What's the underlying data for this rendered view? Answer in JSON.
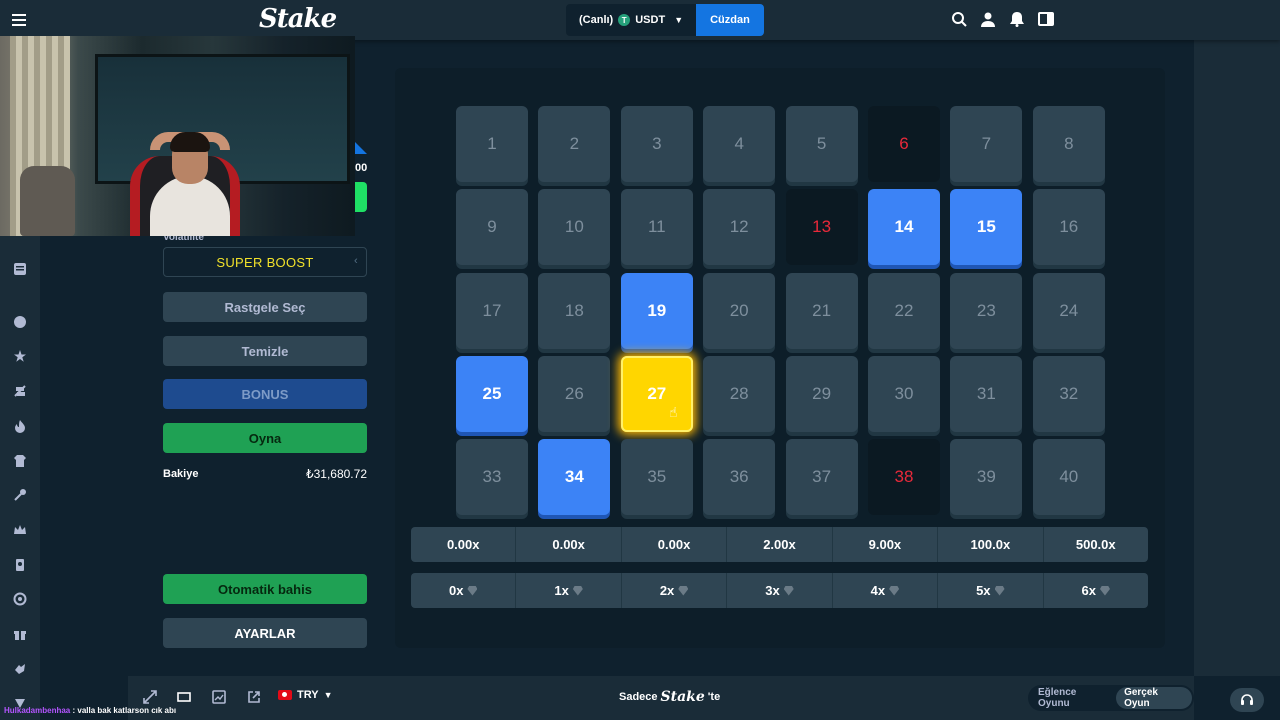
{
  "header": {
    "logo": "Stake",
    "wallet_currency_mode": "(Canlı)",
    "wallet_currency": "USDT",
    "wallet_currency_symbol": "T",
    "wallet_button": "Cüzdan",
    "icons": [
      "search-icon",
      "user-icon",
      "bell-icon",
      "sidebar-toggle-icon"
    ]
  },
  "sidebar_rail": {
    "icons": [
      "menu-icon",
      "document-icon",
      "sport-icon",
      "star-icon",
      "tennis-icon",
      "fire-icon",
      "jersey-icon",
      "key-icon",
      "crown-icon",
      "passport-icon",
      "support-icon",
      "gift-icon",
      "hand-icon",
      "vip-icon"
    ]
  },
  "controls": {
    "partial_value": "00",
    "volatility_label": "Volatilite",
    "boost_select": "SUPER BOOST",
    "random_pick": "Rastgele Seç",
    "clear": "Temizle",
    "bonus": "BONUS",
    "play": "Oyna",
    "balance_label": "Bakiye",
    "balance_value": "₺31,680.72",
    "auto_bet": "Otomatik bahis",
    "settings": "AYARLAR"
  },
  "board": {
    "tiles": [
      {
        "n": "1",
        "state": "empty"
      },
      {
        "n": "2",
        "state": "empty"
      },
      {
        "n": "3",
        "state": "empty"
      },
      {
        "n": "4",
        "state": "empty"
      },
      {
        "n": "5",
        "state": "empty"
      },
      {
        "n": "6",
        "state": "hit"
      },
      {
        "n": "7",
        "state": "empty"
      },
      {
        "n": "8",
        "state": "empty"
      },
      {
        "n": "9",
        "state": "empty"
      },
      {
        "n": "10",
        "state": "empty"
      },
      {
        "n": "11",
        "state": "empty"
      },
      {
        "n": "12",
        "state": "empty"
      },
      {
        "n": "13",
        "state": "hit"
      },
      {
        "n": "14",
        "state": "selected"
      },
      {
        "n": "15",
        "state": "selected"
      },
      {
        "n": "16",
        "state": "empty"
      },
      {
        "n": "17",
        "state": "empty"
      },
      {
        "n": "18",
        "state": "empty"
      },
      {
        "n": "19",
        "state": "selected"
      },
      {
        "n": "20",
        "state": "empty"
      },
      {
        "n": "21",
        "state": "empty"
      },
      {
        "n": "22",
        "state": "empty"
      },
      {
        "n": "23",
        "state": "empty"
      },
      {
        "n": "24",
        "state": "empty"
      },
      {
        "n": "25",
        "state": "selected"
      },
      {
        "n": "26",
        "state": "empty"
      },
      {
        "n": "27",
        "state": "gold"
      },
      {
        "n": "28",
        "state": "empty"
      },
      {
        "n": "29",
        "state": "empty"
      },
      {
        "n": "30",
        "state": "empty"
      },
      {
        "n": "31",
        "state": "empty"
      },
      {
        "n": "32",
        "state": "empty"
      },
      {
        "n": "33",
        "state": "empty"
      },
      {
        "n": "34",
        "state": "selected"
      },
      {
        "n": "35",
        "state": "empty"
      },
      {
        "n": "36",
        "state": "empty"
      },
      {
        "n": "37",
        "state": "empty"
      },
      {
        "n": "38",
        "state": "hit"
      },
      {
        "n": "39",
        "state": "empty"
      },
      {
        "n": "40",
        "state": "empty"
      }
    ],
    "payouts": [
      "0.00x",
      "0.00x",
      "0.00x",
      "2.00x",
      "9.00x",
      "100.0x",
      "500.0x"
    ],
    "hit_counts": [
      "0x",
      "1x",
      "2x",
      "3x",
      "4x",
      "5x",
      "6x"
    ]
  },
  "footer": {
    "currency": "TRY",
    "tagline_prefix": "Sadece",
    "tagline_logo": "Stake",
    "tagline_suffix": "'te",
    "fun_mode": "Eğlence Oyunu",
    "real_mode": "Gerçek Oyun"
  },
  "chat": {
    "user": "Hulkadambenhaa",
    "message": ": valla bak katlarson cık abı"
  },
  "colors": {
    "bg": "#0f212e",
    "panel": "#1a2c38",
    "tile": "#2f4553",
    "selected": "#3c83f6",
    "hit": "#e8293a",
    "gold": "#ffd600",
    "green": "#1fa154",
    "wallet_blue": "#1475e1"
  }
}
